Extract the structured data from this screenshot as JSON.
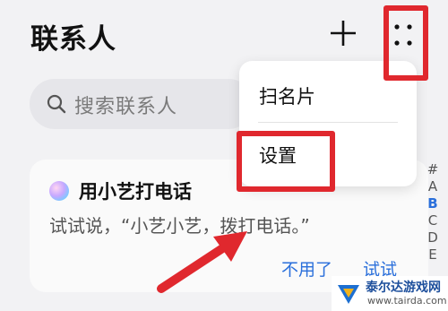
{
  "header": {
    "title": "联系人",
    "add_icon": "plus-icon",
    "more_icon": "more-dots-icon"
  },
  "search": {
    "placeholder": "搜索联系人",
    "icon": "search-icon"
  },
  "menu": {
    "items": [
      {
        "label": "扫名片"
      },
      {
        "label": "设置"
      }
    ]
  },
  "card": {
    "icon": "xiaoyi-icon",
    "title": "用小艺打电话",
    "description": "试试说，“小艺小艺，拨打电话。”",
    "dismiss_label": "不用了",
    "try_label": "试试"
  },
  "index_bar": {
    "letters": [
      "#",
      "A",
      "B",
      "C",
      "D",
      "E"
    ],
    "active": "B"
  },
  "annotation": {
    "highlight_color": "#e0282e"
  },
  "watermark": {
    "name": "泰尔达游戏网",
    "url": "www.tairda.com"
  }
}
